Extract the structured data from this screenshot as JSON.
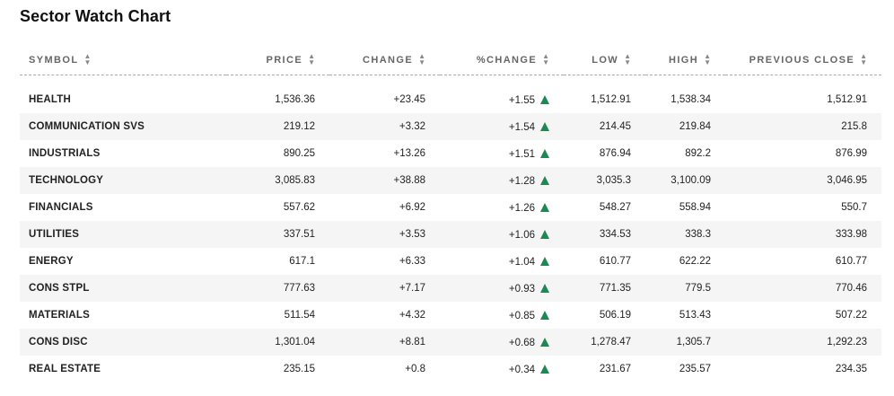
{
  "title": "Sector Watch Chart",
  "columns": {
    "symbol": "SYMBOL",
    "price": "PRICE",
    "change": "CHANGE",
    "pct_change": "%CHANGE",
    "low": "LOW",
    "high": "HIGH",
    "previous_close": "PREVIOUS CLOSE"
  },
  "sort_icon": "sort-updown-icon",
  "colors": {
    "positive": "#188a52",
    "row_alt": "#f5f5f5"
  },
  "rows": [
    {
      "symbol": "HEALTH",
      "price": "1,536.36",
      "change": "+23.45",
      "pct_change": "+1.55",
      "low": "1,512.91",
      "high": "1,538.34",
      "previous_close": "1,512.91"
    },
    {
      "symbol": "COMMUNICATION SVS",
      "price": "219.12",
      "change": "+3.32",
      "pct_change": "+1.54",
      "low": "214.45",
      "high": "219.84",
      "previous_close": "215.8"
    },
    {
      "symbol": "INDUSTRIALS",
      "price": "890.25",
      "change": "+13.26",
      "pct_change": "+1.51",
      "low": "876.94",
      "high": "892.2",
      "previous_close": "876.99"
    },
    {
      "symbol": "TECHNOLOGY",
      "price": "3,085.83",
      "change": "+38.88",
      "pct_change": "+1.28",
      "low": "3,035.3",
      "high": "3,100.09",
      "previous_close": "3,046.95"
    },
    {
      "symbol": "FINANCIALS",
      "price": "557.62",
      "change": "+6.92",
      "pct_change": "+1.26",
      "low": "548.27",
      "high": "558.94",
      "previous_close": "550.7"
    },
    {
      "symbol": "UTILITIES",
      "price": "337.51",
      "change": "+3.53",
      "pct_change": "+1.06",
      "low": "334.53",
      "high": "338.3",
      "previous_close": "333.98"
    },
    {
      "symbol": "ENERGY",
      "price": "617.1",
      "change": "+6.33",
      "pct_change": "+1.04",
      "low": "610.77",
      "high": "622.22",
      "previous_close": "610.77"
    },
    {
      "symbol": "CONS STPL",
      "price": "777.63",
      "change": "+7.17",
      "pct_change": "+0.93",
      "low": "771.35",
      "high": "779.5",
      "previous_close": "770.46"
    },
    {
      "symbol": "MATERIALS",
      "price": "511.54",
      "change": "+4.32",
      "pct_change": "+0.85",
      "low": "506.19",
      "high": "513.43",
      "previous_close": "507.22"
    },
    {
      "symbol": "CONS DISC",
      "price": "1,301.04",
      "change": "+8.81",
      "pct_change": "+0.68",
      "low": "1,278.47",
      "high": "1,305.7",
      "previous_close": "1,292.23"
    },
    {
      "symbol": "REAL ESTATE",
      "price": "235.15",
      "change": "+0.8",
      "pct_change": "+0.34",
      "low": "231.67",
      "high": "235.57",
      "previous_close": "234.35"
    }
  ]
}
